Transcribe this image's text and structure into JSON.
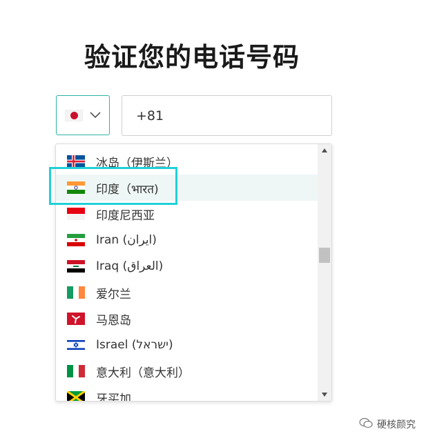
{
  "heading": "验证您的电话号码",
  "country_select": {
    "selected_flag": "jp-flag",
    "selected_country": "Japan"
  },
  "phone": {
    "value": "+81"
  },
  "dropdown": {
    "items": [
      {
        "label": "冰岛（伊斯兰）",
        "flag": "flag-iceland"
      },
      {
        "label": "印度（भारत)",
        "flag": "flag-india"
      },
      {
        "label": "印度尼西亚",
        "flag": "flag-indonesia"
      },
      {
        "label": "Iran (‫ایران‬‎)",
        "flag": "flag-iran"
      },
      {
        "label": "Iraq (‫العراق‬‎)",
        "flag": "flag-iraq"
      },
      {
        "label": "爱尔兰",
        "flag": "flag-ireland"
      },
      {
        "label": "马恩岛",
        "flag": "flag-isle-of-man"
      },
      {
        "label": "Israel (‫ישראל‬‎)",
        "flag": "flag-israel"
      },
      {
        "label": "意大利（意大利）",
        "flag": "flag-italy"
      },
      {
        "label": "牙买加",
        "flag": "flag-jamaica"
      }
    ],
    "active_index": 1
  },
  "highlight_color": "#1fd0d8",
  "accent_color": "#2bb3a6",
  "watermark": {
    "text": "硬核颜究"
  }
}
